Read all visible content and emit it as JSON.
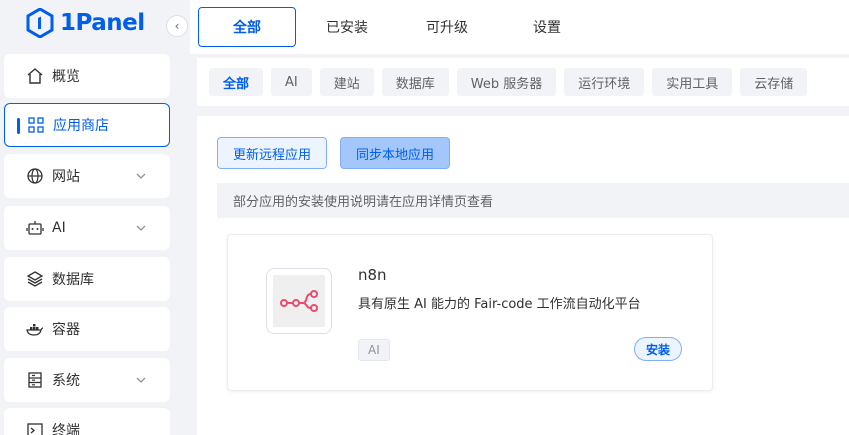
{
  "brand": {
    "name": "1Panel",
    "color": "#005eeb"
  },
  "sidebar": {
    "collapse_icon": "chevron-left-icon",
    "items": [
      {
        "label": "概览",
        "icon": "home-icon",
        "has_submenu": false
      },
      {
        "label": "应用商店",
        "icon": "grid-icon",
        "has_submenu": false,
        "active": true
      },
      {
        "label": "网站",
        "icon": "globe-icon",
        "has_submenu": true
      },
      {
        "label": "AI",
        "icon": "robot-icon",
        "has_submenu": true
      },
      {
        "label": "数据库",
        "icon": "layers-icon",
        "has_submenu": false
      },
      {
        "label": "容器",
        "icon": "docker-icon",
        "has_submenu": false
      },
      {
        "label": "系统",
        "icon": "server-icon",
        "has_submenu": true
      },
      {
        "label": "终端",
        "icon": "terminal-icon",
        "has_submenu": false
      }
    ]
  },
  "tabs": [
    {
      "label": "全部",
      "active": true
    },
    {
      "label": "已安装"
    },
    {
      "label": "可升级"
    },
    {
      "label": "设置"
    }
  ],
  "categories": [
    {
      "label": "全部",
      "active": true
    },
    {
      "label": "AI"
    },
    {
      "label": "建站"
    },
    {
      "label": "数据库"
    },
    {
      "label": "Web 服务器"
    },
    {
      "label": "运行环境"
    },
    {
      "label": "实用工具"
    },
    {
      "label": "云存储"
    }
  ],
  "actions": {
    "update_remote": "更新远程应用",
    "sync_local": "同步本地应用"
  },
  "notice": "部分应用的安装使用说明请在应用详情页查看",
  "apps": [
    {
      "name": "n8n",
      "description": "具有原生 AI 能力的 Fair-code 工作流自动化平台",
      "tag": "AI",
      "install_label": "安装",
      "icon": "n8n-logo-icon",
      "icon_color": "#ea4b71"
    }
  ]
}
